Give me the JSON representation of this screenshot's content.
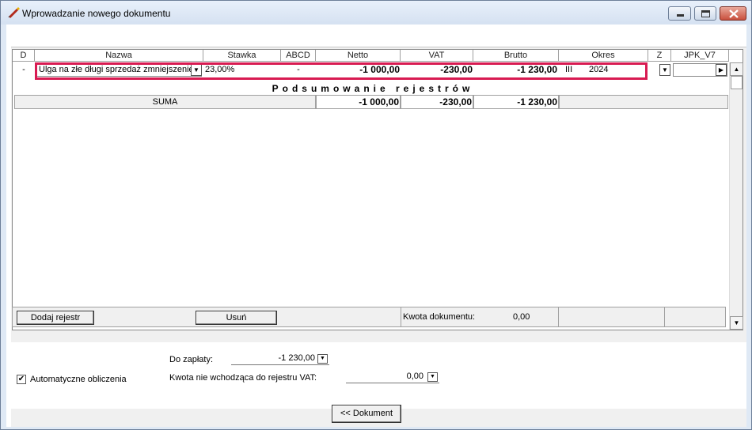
{
  "window": {
    "title": "Wprowadzanie nowego dokumentu"
  },
  "grid": {
    "columns": [
      "D",
      "Nazwa",
      "Stawka",
      "ABCD",
      "Netto",
      "VAT",
      "Brutto",
      "Okres",
      "Z",
      "JPK_V7"
    ],
    "row": {
      "d": "-",
      "nazwa": "Ulga na złe długi sprzedaż zmniejszenie",
      "stawka": "23,00%",
      "abcd": "-",
      "netto": "-1 000,00",
      "vat": "-230,00",
      "brutto": "-1 230,00",
      "okres_month": "III",
      "okres_year": "2024"
    },
    "summary_title": "Podsumowanie rejestrów",
    "summary": {
      "label": "SUMA",
      "netto": "-1 000,00",
      "vat": "-230,00",
      "brutto": "-1 230,00"
    }
  },
  "bottom_bar": {
    "add_label": "Dodaj rejestr",
    "remove_label": "Usuń",
    "doc_amount_label": "Kwota dokumentu:",
    "doc_amount_value": "0,00"
  },
  "lower": {
    "to_pay_label": "Do zapłaty:",
    "to_pay_value": "-1 230,00",
    "excluded_label": "Kwota nie wchodząca do rejestru VAT:",
    "excluded_value": "0,00",
    "auto_calc_label": "Automatyczne obliczenia",
    "auto_calc_checked": true,
    "document_button": "<< Dokument"
  },
  "icons": {
    "window": "pen-icon",
    "minimize": "minimize-icon",
    "maximize": "maximize-icon",
    "close": "close-icon"
  },
  "colors": {
    "highlight": "#d81b52"
  }
}
